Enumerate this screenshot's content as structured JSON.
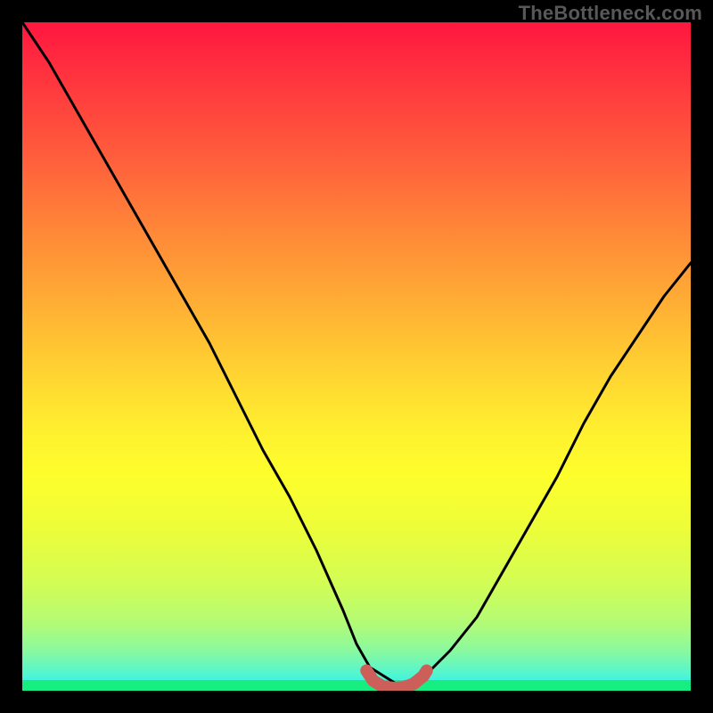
{
  "watermark": {
    "text": "TheBottleneck.com"
  },
  "colors": {
    "frame": "#000000",
    "curve": "#000000",
    "marker": "#cd5f5b",
    "green_band": "#17ee81"
  },
  "chart_data": {
    "type": "line",
    "title": "",
    "xlabel": "",
    "ylabel": "",
    "xlim": [
      0,
      1
    ],
    "ylim": [
      0,
      1
    ],
    "series": [
      {
        "name": "bottleneck-curve",
        "x": [
          0.0,
          0.04,
          0.08,
          0.12,
          0.16,
          0.2,
          0.24,
          0.28,
          0.32,
          0.36,
          0.4,
          0.44,
          0.48,
          0.5,
          0.52,
          0.56,
          0.58,
          0.6,
          0.64,
          0.68,
          0.72,
          0.76,
          0.8,
          0.84,
          0.88,
          0.92,
          0.96,
          1.0
        ],
        "y": [
          1.0,
          0.94,
          0.87,
          0.8,
          0.73,
          0.66,
          0.59,
          0.52,
          0.44,
          0.36,
          0.29,
          0.21,
          0.12,
          0.07,
          0.035,
          0.01,
          0.01,
          0.02,
          0.06,
          0.11,
          0.18,
          0.25,
          0.32,
          0.4,
          0.47,
          0.53,
          0.59,
          0.64
        ]
      },
      {
        "name": "low-bottleneck-marker",
        "x": [
          0.515,
          0.525,
          0.54,
          0.555,
          0.57,
          0.585,
          0.6,
          0.605
        ],
        "y": [
          0.03,
          0.015,
          0.006,
          0.004,
          0.005,
          0.01,
          0.022,
          0.03
        ]
      }
    ],
    "annotations": []
  }
}
